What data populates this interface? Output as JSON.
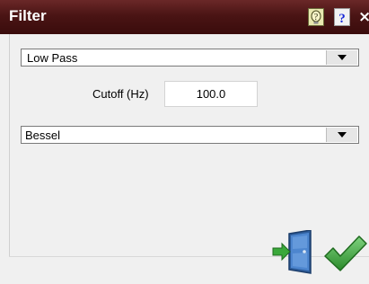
{
  "window": {
    "title": "Filter",
    "close_glyph": "×"
  },
  "titlebar_buttons": {
    "help_icon": "context-help-icon",
    "question_icon": "question-icon",
    "close_icon": "close-icon"
  },
  "filter_type": {
    "selected": "Low Pass"
  },
  "cutoff": {
    "label": "Cutoff (Hz)",
    "value": "100.0"
  },
  "filter_design": {
    "selected": "Bessel"
  },
  "footer": {
    "exit_icon": "exit-door-icon",
    "ok_icon": "checkmark-icon"
  },
  "colors": {
    "titlebar": "#4a1414",
    "ok_green": "#3aa83a",
    "door_blue": "#3c6fb3"
  }
}
